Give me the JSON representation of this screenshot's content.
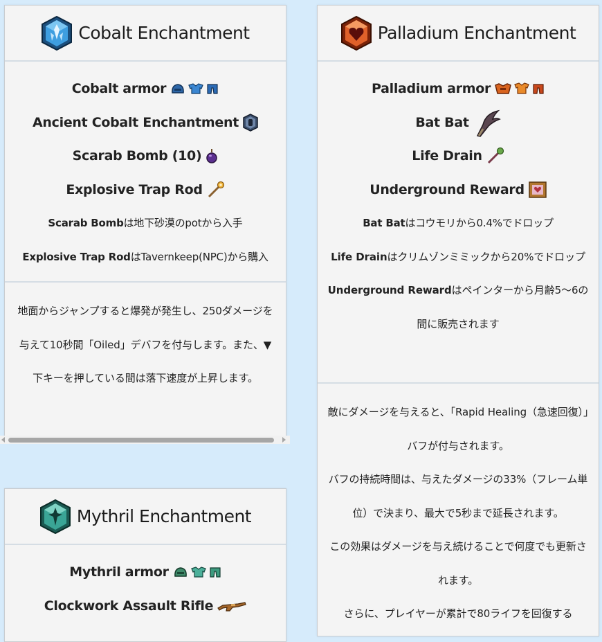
{
  "cobalt": {
    "title": "Cobalt Enchantment",
    "items": [
      {
        "label": "Cobalt armor",
        "icons": [
          "helmet-icon",
          "breastplate-icon",
          "leggings-icon"
        ]
      },
      {
        "label": "Ancient Cobalt Enchantment",
        "icons": [
          "enchantment-icon"
        ]
      },
      {
        "label": "Scarab Bomb (10)",
        "icons": [
          "bomb-icon"
        ]
      },
      {
        "label": "Explosive Trap Rod",
        "icons": [
          "rod-icon"
        ]
      }
    ],
    "notes": [
      {
        "bold": "Scarab Bomb",
        "text": "は地下砂漠のpotから入手"
      },
      {
        "bold": "Explosive Trap Rod",
        "text": "はTavernkeep(NPC)から購入"
      }
    ],
    "description": "地面からジャンプすると爆発が発生し、250ダメージを与えて10秒間「Oiled」デバフを付与します。また、▼下キーを押している間は落下速度が上昇します。"
  },
  "palladium": {
    "title": "Palladium Enchantment",
    "items": [
      {
        "label": "Palladium armor",
        "icons": [
          "helmet-icon",
          "breastplate-icon",
          "leggings-icon"
        ]
      },
      {
        "label": "Bat Bat",
        "icons": [
          "bat-bat-icon"
        ]
      },
      {
        "label": "Life Drain",
        "icons": [
          "staff-icon"
        ]
      },
      {
        "label": "Underground Reward",
        "icons": [
          "painting-icon"
        ]
      }
    ],
    "notes": [
      {
        "bold": "Bat Bat",
        "text": "はコウモリから0.4%でドロップ"
      },
      {
        "bold": "Life Drain",
        "text": "はクリムゾンミミックから20%でドロップ"
      },
      {
        "bold": "Underground Reward",
        "text": "はペインターから月齢5～6の間に販売されます"
      }
    ],
    "description": [
      "敵にダメージを与えると、「Rapid Healing（急速回復）」バフが付与されます。",
      "バフの持続時間は、与えたダメージの33%（フレーム単位）で決まり、最大で5秒まで延長されます。",
      "この効果はダメージを与え続けることで何度でも更新されます。",
      "さらに、プレイヤーが累計で80ライフを回復する"
    ]
  },
  "mythril": {
    "title": "Mythril Enchantment",
    "items": [
      {
        "label": "Mythril armor",
        "icons": [
          "helmet-icon",
          "breastplate-icon",
          "leggings-icon"
        ]
      },
      {
        "label": "Clockwork Assault Rifle",
        "icons": [
          "rifle-icon"
        ]
      }
    ]
  },
  "colors": {
    "page_bg": "#d6ebfb",
    "card_bg": "#f4f4f4",
    "divider": "#d5dde4",
    "cobalt": "#2f8fd6",
    "palladium": "#d2521e",
    "mythril": "#2f9a8a"
  }
}
